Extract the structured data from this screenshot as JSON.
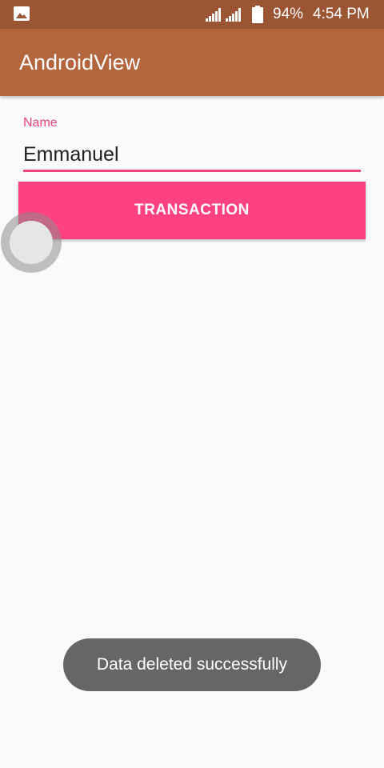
{
  "status_bar": {
    "battery_percent": "94%",
    "time": "4:54 PM",
    "icons": [
      "gallery-icon",
      "signal-icon",
      "signal-icon",
      "battery-icon"
    ]
  },
  "app_bar": {
    "title": "AndroidView"
  },
  "form": {
    "name_label": "Name",
    "name_value": "Emmanuel"
  },
  "transaction_button": {
    "label": "TRANSACTION"
  },
  "toast": {
    "message": "Data deleted successfully"
  },
  "colors": {
    "status_bar": "#9c5532",
    "app_bar": "#b3663e",
    "accent": "#ff4081",
    "label_pink": "#ec407a",
    "toast_bg": "#666666",
    "background": "#fafafa"
  }
}
